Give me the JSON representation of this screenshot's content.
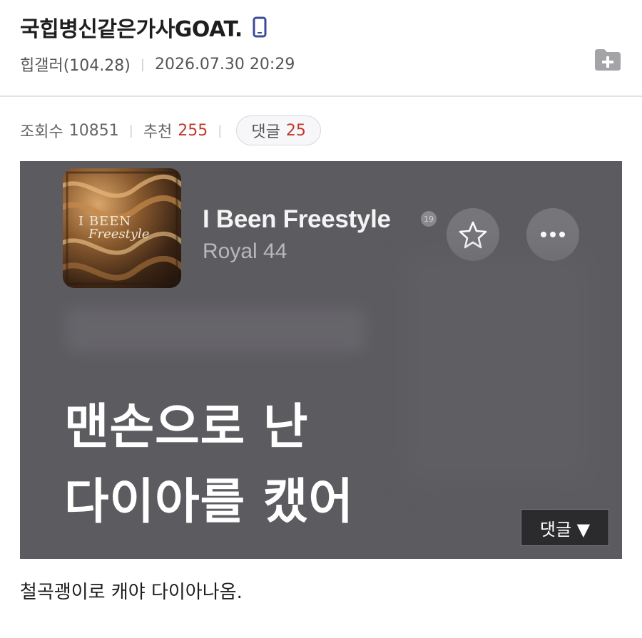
{
  "post": {
    "title": "국힙병신같은가사GOAT.",
    "author": "힙갤러(104.28)",
    "datetime": "2026.07.30 20:29"
  },
  "stats": {
    "views_label": "조회수",
    "views": "10851",
    "recommend_label": "추천",
    "recommend": "255",
    "comments_label": "댓글",
    "comments": "25"
  },
  "image": {
    "album_art_text_line1": "I BEEN",
    "album_art_text_line2": "Freestyle",
    "song_title": "I Been Freestyle",
    "explicit_badge": "19",
    "artist": "Royal 44",
    "lyric_line1": "맨손으로 난",
    "lyric_line2": "다이아를 캤어",
    "comment_dropdown_label": "댓글 ▼"
  },
  "body": {
    "text": "철곡괭이로 캐야 다이아나옴."
  },
  "icons": {
    "mobile": "mobile-phone-icon",
    "add": "add-folder-icon",
    "star": "star-icon",
    "more": "more-dots-icon"
  },
  "colors": {
    "accent_red": "#c0392b",
    "mobile_icon_blue": "#3b4a9c",
    "image_bg": "#5c5b60"
  }
}
